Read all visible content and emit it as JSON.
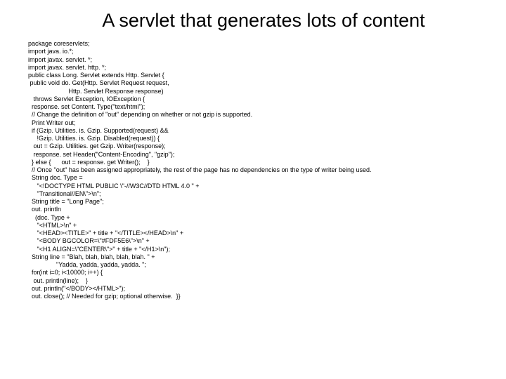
{
  "title": "A servlet that generates lots of content",
  "code_lines": [
    "package coreservlets;",
    "import java. io.*;",
    "import javax. servlet. *;",
    "import javax. servlet. http. *;",
    "public class Long. Servlet extends Http. Servlet {",
    " public void do. Get(Http. Servlet Request request,",
    "                       Http. Servlet Response response)",
    "   throws Servlet Exception, IOException {",
    "  response. set Content. Type(\"text/html\");",
    "  // Change the definition of \"out\" depending on whether or not gzip is supported.",
    "  Print Writer out;",
    "  if (Gzip. Utilities. is. Gzip. Supported(request) &&",
    "     !Gzip. Utilities. is. Gzip. Disabled(request)) {",
    "   out = Gzip. Utilities. get Gzip. Writer(response);",
    "   response. set Header(\"Content-Encoding\", \"gzip\");",
    "  } else {      out = response. get Writer();    }",
    "  // Once \"out\" has been assigned appropriately, the rest of the page has no dependencies on the type of writer being used.",
    "  String doc. Type =",
    "     \"<!DOCTYPE HTML PUBLIC \\\"-//W3C//DTD HTML 4.0 \" +",
    "     \"Transitional//EN\\\">\\n\";",
    "  String title = \"Long Page\";",
    "  out. println",
    "    (doc. Type +",
    "     \"<HTML>\\n\" +",
    "     \"<HEAD><TITLE>\" + title + \"</TITLE></HEAD>\\n\" +",
    "     \"<BODY BGCOLOR=\\\"#FDF5E6\\\">\\n\" +",
    "     \"<H1 ALIGN=\\\"CENTER\\\">\" + title + \"</H1>\\n\");",
    "  String line = \"Blah, blah, blah, blah, blah. \" +",
    "                \"Yadda, yadda, yadda, yadda. \";",
    "  for(int i=0; i<10000; i++) {",
    "   out. println(line);    }",
    "  out. println(\"</BODY></HTML>\");",
    "  out. close(); // Needed for gzip; optional otherwise.  }}"
  ]
}
